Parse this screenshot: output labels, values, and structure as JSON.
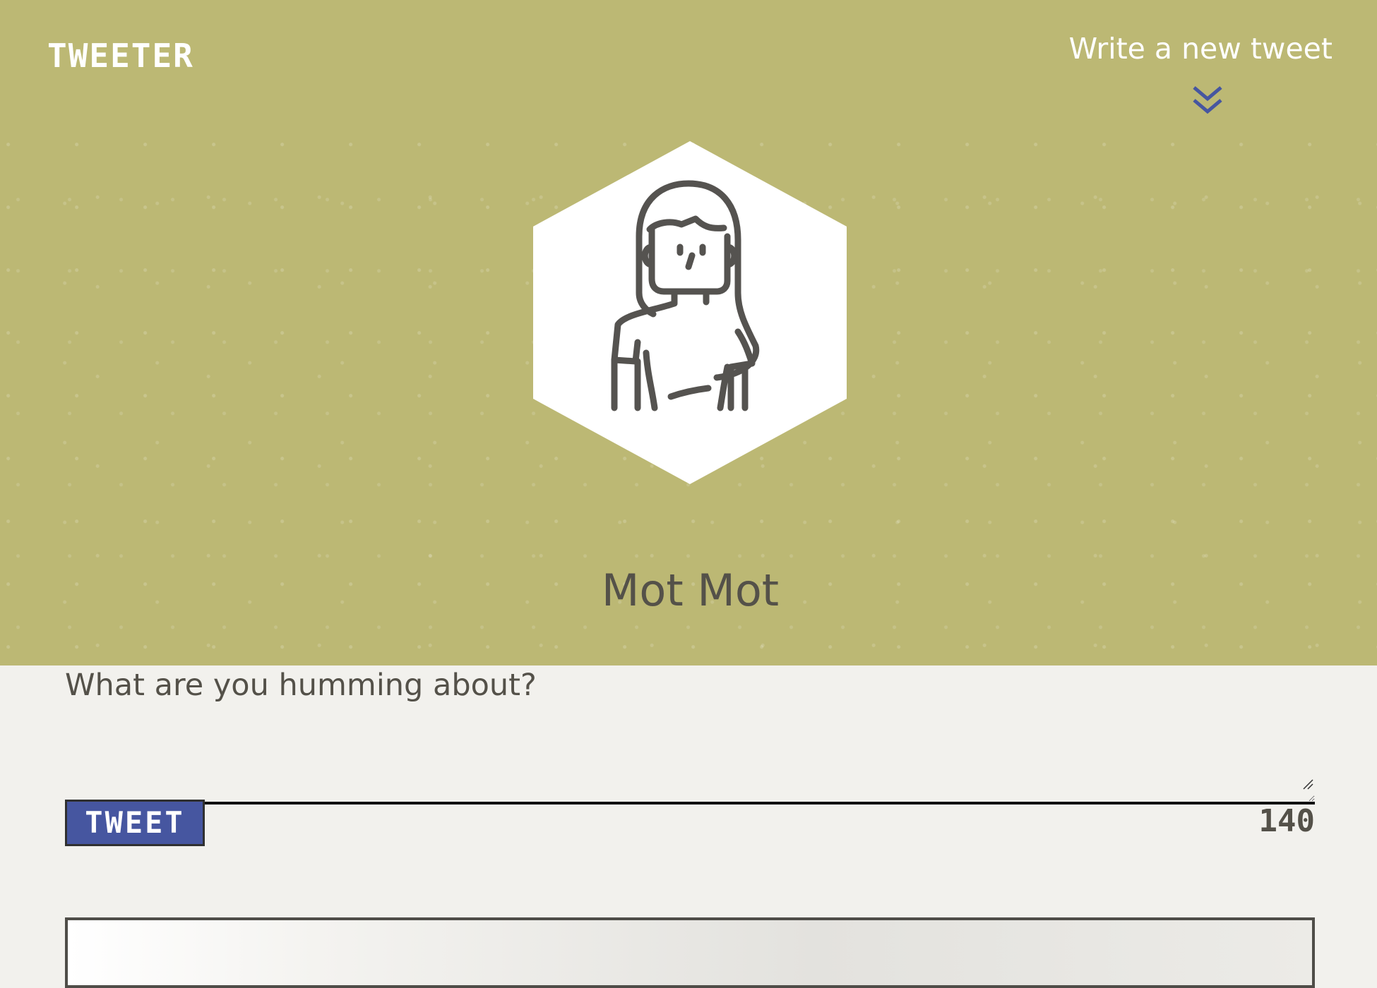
{
  "brand": {
    "logo_text": "TWEETER",
    "background_color": "#bcb874",
    "accent_color": "#4656a0"
  },
  "nav": {
    "compose_link_label": "Write a new tweet",
    "compose_icon": "double-chevron-down-icon"
  },
  "profile": {
    "name": "Mot Mot",
    "avatar_icon": "woman-avatar-icon"
  },
  "composer": {
    "prompt": "What are you humming about?",
    "textarea_value": "",
    "submit_label": "TWEET",
    "char_counter": "140"
  }
}
